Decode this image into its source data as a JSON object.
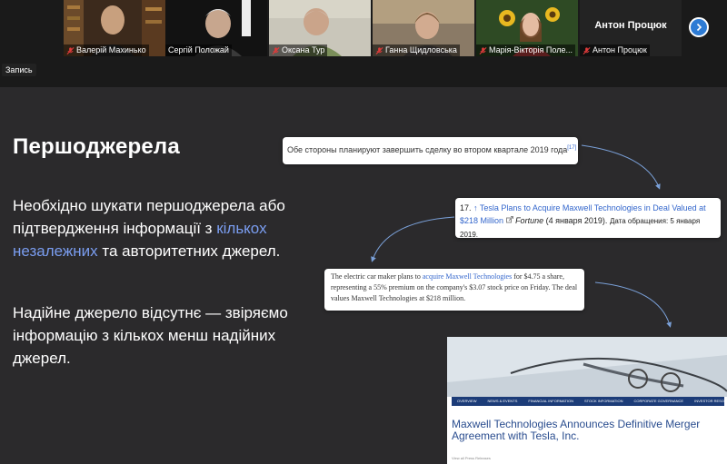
{
  "participants": [
    {
      "name": "Валерій Махинько",
      "muted": true,
      "active": false
    },
    {
      "name": "Сергій Положай",
      "muted": false,
      "active": true
    },
    {
      "name": "Оксана Тур",
      "muted": true,
      "active": false
    },
    {
      "name": "Ганна Щидловська",
      "muted": true,
      "active": false
    },
    {
      "name": "Марія-Вікторія Поле...",
      "muted": true,
      "active": false
    },
    {
      "name": "Антон Процюк",
      "muted": true,
      "active": false
    }
  ],
  "big_name": "Антон Процюк",
  "recording_label": "Запись",
  "slide": {
    "title": "Першоджерела",
    "text1_before": "Необхідно шукати першоджерела або підтвердження інформації з ",
    "text1_accent": "кількох незалежних",
    "text1_after": " та авторитетних джерел.",
    "text2": "Надійне джерело відсутнє — звіряємо інформацію з кількох менш надійних джерел."
  },
  "card1": {
    "text": "Обе стороны планируют завершить сделку во втором квартале 2019 года",
    "ref": "[17]"
  },
  "card2": {
    "num": "17.",
    "up": "↑",
    "link": "Tesla Plans to Acquire Maxwell Technologies in Deal Valued at $218 Million",
    "source": "Fortune",
    "date": " (4 января 2019).",
    "access": "Дата обращения: 5 января 2019."
  },
  "card3": {
    "before": "The electric car maker plans to ",
    "link": "acquire Maxwell Technologies",
    "after": " for $4.75 a share, representing a 55% premium on the company's $3.07 stock price on Friday. The deal values Maxwell Technologies at $218 million."
  },
  "site": {
    "nav": [
      "OVERVIEW",
      "NEWS & EVENTS",
      "FINANCIAL INFORMATION",
      "STOCK INFORMATION",
      "CORPORATE GOVERNANCE",
      "INVESTOR RESOUR"
    ],
    "headline": "Maxwell Technologies Announces Definitive Merger Agreement with Tesla, Inc.",
    "meta": "View all Press Releases"
  },
  "colors": {
    "accent": "#7a9df0",
    "active_border": "#7bbf3f",
    "next_button": "#2d7bd4"
  }
}
